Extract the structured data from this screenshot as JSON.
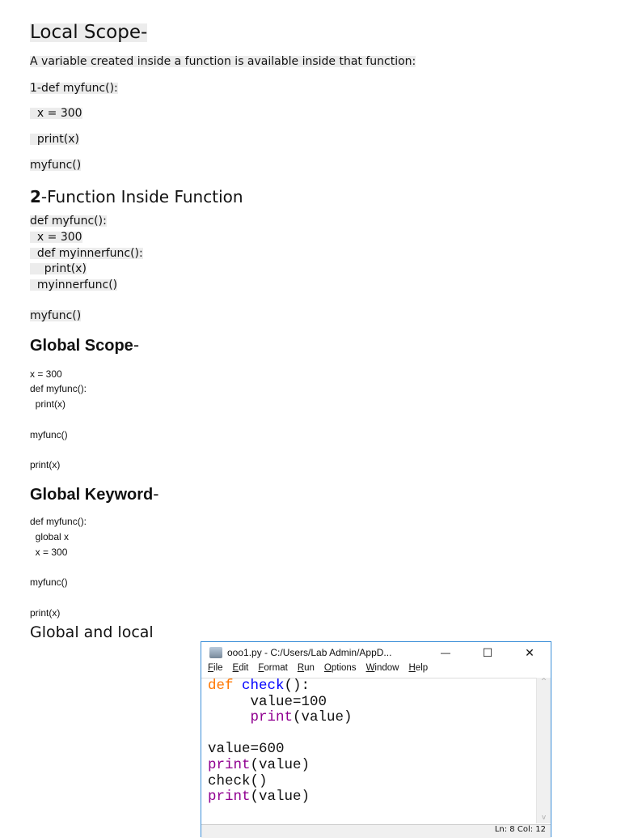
{
  "local_scope": {
    "heading": "Local Scope-",
    "description": "A variable created inside a function is available inside that function:",
    "lines": [
      "1-def myfunc():",
      "  x = 300",
      "  print(x)",
      "myfunc()"
    ]
  },
  "function_inside": {
    "heading_num": "2",
    "heading": "-Function Inside Function",
    "lines": [
      "def myfunc():",
      "  x = 300",
      "  def myinnerfunc():",
      "    print(x)",
      "  myinnerfunc()",
      "myfunc()"
    ]
  },
  "global_scope": {
    "heading": "Global Scope",
    "dash": "-",
    "lines": [
      "x = 300",
      "def myfunc():",
      "  print(x)",
      "myfunc()",
      "print(x)"
    ]
  },
  "global_keyword": {
    "heading": "Global Keyword",
    "dash": "-",
    "lines": [
      "def myfunc():",
      "  global x",
      "  x = 300",
      "myfunc()",
      "print(x)"
    ]
  },
  "global_and_local": {
    "heading": "Global and local"
  },
  "idle_window": {
    "title": "ooo1.py - C:/Users/Lab Admin/AppD...",
    "minimize": "—",
    "maximize": "☐",
    "close": "✕",
    "menu": [
      "File",
      "Edit",
      "Format",
      "Run",
      "Options",
      "Window",
      "Help"
    ],
    "code": {
      "def": "def",
      "fname": "check",
      "sig": "():",
      "l2": "     value=100",
      "print": "print",
      "arg": "(value)",
      "l4": "value=600",
      "check": "check()"
    },
    "status": "Ln: 8  Col: 12",
    "scroll_up": "^",
    "scroll_down": "v"
  }
}
